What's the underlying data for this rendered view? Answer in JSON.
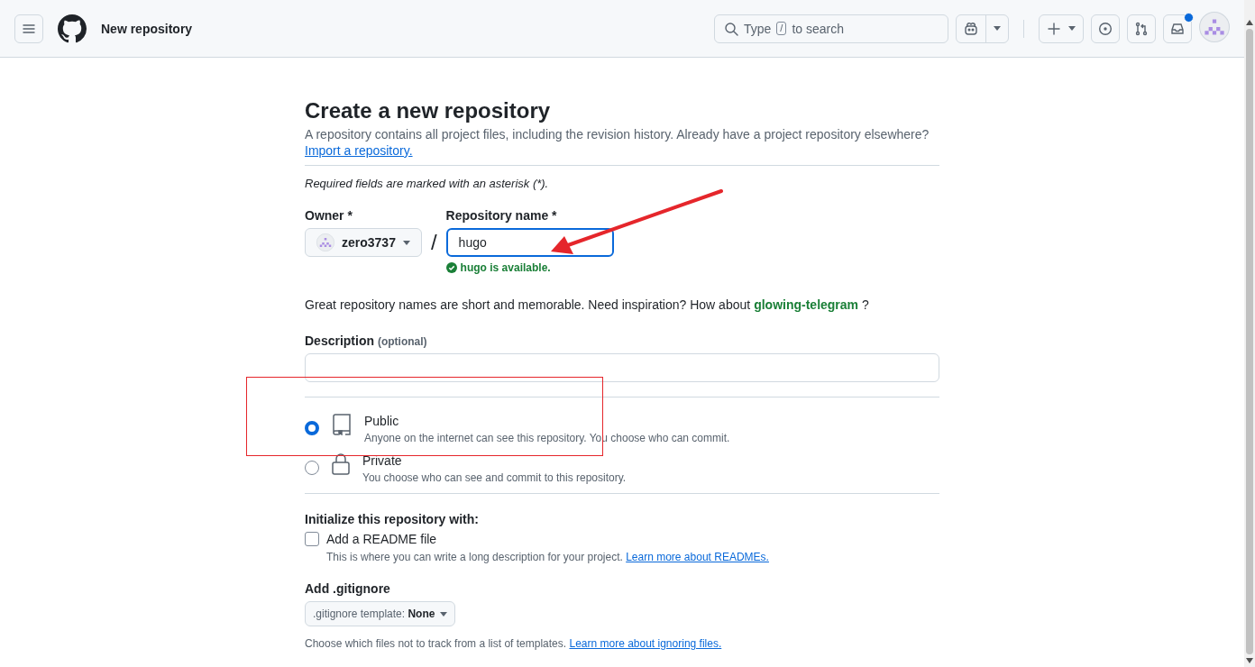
{
  "header": {
    "title": "New repository",
    "search": {
      "prefix": "Type",
      "key": "/",
      "suffix": "to search"
    },
    "notifications": {
      "unread": true
    }
  },
  "form": {
    "title": "Create a new repository",
    "intro": "A repository contains all project files, including the revision history. Already have a project repository elsewhere?",
    "import_link": "Import a repository.",
    "required_note": "Required fields are marked with an asterisk (*).",
    "owner": {
      "label": "Owner *",
      "value": "zero3737"
    },
    "separator": "/",
    "repo_name": {
      "label": "Repository name *",
      "value": "hugo",
      "status": "hugo is available."
    },
    "suggestion": {
      "text": "Great repository names are short and memorable. Need inspiration? How about",
      "name": "glowing-telegram",
      "suffix": "?"
    },
    "description": {
      "label": "Description",
      "optional": "(optional)"
    },
    "visibility": [
      {
        "kind": "public",
        "label": "Public",
        "description": "Anyone on the internet can see this repository. You choose who can commit.",
        "selected": true
      },
      {
        "kind": "private",
        "label": "Private",
        "description": "You choose who can see and commit to this repository.",
        "selected": false
      }
    ],
    "init": {
      "heading": "Initialize this repository with:",
      "readme": {
        "label": "Add a README file",
        "checked": false,
        "help": "This is where you can write a long description for your project.",
        "link": "Learn more about READMEs."
      }
    },
    "gitignore": {
      "heading": "Add .gitignore",
      "button_label": ".gitignore template:",
      "button_value": "None",
      "help": "Choose which files not to track from a list of templates.",
      "link": "Learn more about ignoring files."
    }
  }
}
